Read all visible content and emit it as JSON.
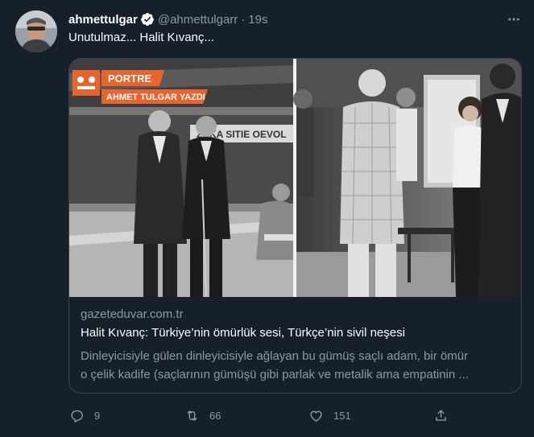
{
  "author": {
    "display_name": "ahmettulgar",
    "handle": "@ahmettulgarr",
    "separator": "·",
    "time": "19s"
  },
  "tweet": {
    "text": "Unutulmaz... Halit Kıvanç..."
  },
  "card": {
    "image_overlay": {
      "badge_label": "PORTRE",
      "byline": "AHMET TULGAR YAZDI",
      "sign_text": "ZAKA        SITIE OEVOL"
    },
    "domain": "gazeteduvar.com.tr",
    "title": "Halit Kıvanç: Türkiye’nin ömürlük sesi, Türkçe’nin sivil neşesi",
    "description_line1": "Dinleyicisiyle gülen dinleyicisiyle ağlayan bu gümüş saçlı adam, bir ömür",
    "description_line2": "o çelik kadife (saçlarının gümüşü gibi parlak ve metalik ama empatinin ..."
  },
  "actions": {
    "reply_count": "9",
    "retweet_count": "66",
    "like_count": "151"
  },
  "colors": {
    "background": "#15202b",
    "secondary_text": "#8b98a5",
    "border": "#38444d",
    "verified": "#ffffff",
    "badge_orange": "#e8642c"
  },
  "icons": [
    "avatar",
    "verified-badge-icon",
    "more-icon",
    "reply-icon",
    "retweet-icon",
    "like-icon",
    "share-icon"
  ]
}
